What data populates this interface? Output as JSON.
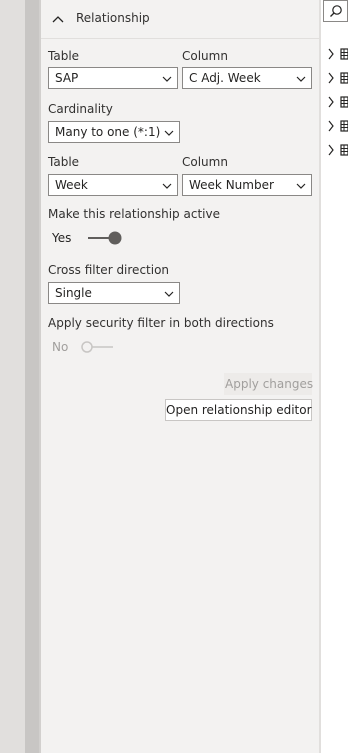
{
  "section": {
    "title": "Relationship"
  },
  "from": {
    "table_label": "Table",
    "table_value": "SAP",
    "column_label": "Column",
    "column_value": "C Adj. Week"
  },
  "cardinality": {
    "label": "Cardinality",
    "value": "Many to one (*:1)"
  },
  "to": {
    "table_label": "Table",
    "table_value": "Week",
    "column_label": "Column",
    "column_value": "Week Number"
  },
  "active": {
    "label": "Make this relationship active",
    "state": "Yes"
  },
  "cross_filter": {
    "label": "Cross filter direction",
    "value": "Single"
  },
  "security": {
    "label": "Apply security filter in both directions",
    "state": "No"
  },
  "buttons": {
    "apply": "Apply changes",
    "open_editor": "Open relationship editor"
  },
  "colors": {
    "toggle_on": "#605e5c",
    "toggle_off": "#c8c6c4",
    "border": "#8a8886"
  },
  "fields_pane": {
    "items": [
      "table-icon",
      "table-icon",
      "table-icon",
      "table-icon",
      "table-icon"
    ]
  }
}
